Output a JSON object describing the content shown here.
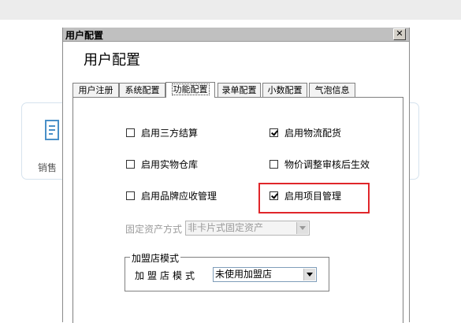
{
  "background": {
    "card_label": "销售"
  },
  "dialog": {
    "title": "用户配置",
    "close_glyph": "✕",
    "heading": "用户配置",
    "tabs": [
      "用户注册",
      "系统配置",
      "功能配置",
      "录单配置",
      "小数配置",
      "气泡信息"
    ],
    "active_tab": 2,
    "options": [
      {
        "label": "启用三方结算",
        "checked": false
      },
      {
        "label": "启用物流配货",
        "checked": true
      },
      {
        "label": "启用实物仓库",
        "checked": false
      },
      {
        "label": "物价调整审核后生效",
        "checked": false
      },
      {
        "label": "启用品牌应收管理",
        "checked": false
      },
      {
        "label": "启用项目管理",
        "checked": true
      }
    ],
    "fixed_asset": {
      "label": "固定资产方式",
      "value": "非卡片式固定资产"
    },
    "franchise": {
      "group_title": "加盟店模式",
      "label": "加盟店模式",
      "value": "未使用加盟店"
    }
  },
  "colors": {
    "highlight": "#e0262a",
    "titlebar": "#c0c0c0"
  }
}
